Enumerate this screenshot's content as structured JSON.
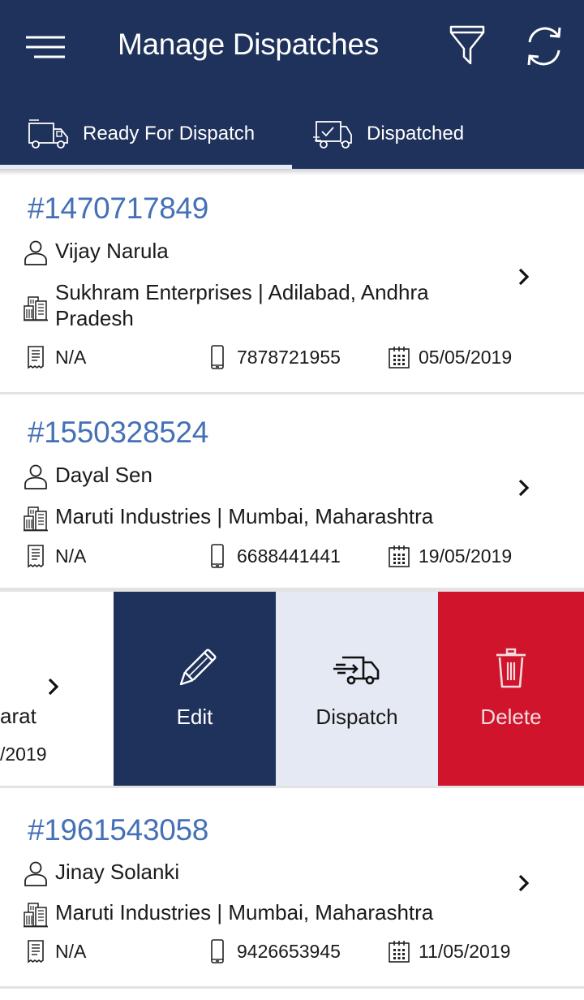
{
  "appbar": {
    "title": "Manage Dispatches",
    "menu_icon": "hamburger-menu-icon",
    "filter_icon": "filter-funnel-icon",
    "refresh_icon": "refresh-icon"
  },
  "tabs": [
    {
      "label": "Ready For Dispatch",
      "icon": "truck-icon",
      "active": true
    },
    {
      "label": "Dispatched",
      "icon": "truck-check-icon",
      "active": false
    }
  ],
  "colors": {
    "primary": "#1f325c",
    "order_id": "#4470b6",
    "delete": "#cf142b",
    "dispatch_bg": "#e5e9f3"
  },
  "orders": [
    {
      "id": "#1470717849",
      "customer": "Vijay Narula",
      "company_line1": "Sukhram Enterprises | Adilabad, Andhra",
      "company_line2": "Pradesh",
      "invoice": "N/A",
      "phone": "7878721955",
      "date": "05/05/2019"
    },
    {
      "id": "#1550328524",
      "customer": "Dayal Sen",
      "company_line1": "Maruti Industries | Mumbai, Maharashtra",
      "invoice": "N/A",
      "phone": "6688441441",
      "date": "19/05/2019"
    },
    {
      "id": "#1961543058",
      "customer": "Jinay Solanki",
      "company_line1": "Maruti Industries | Mumbai, Maharashtra",
      "invoice": "N/A",
      "phone": "9426653945",
      "date": "11/05/2019"
    }
  ],
  "swiped_row": {
    "peek_location_fragment": "arat",
    "peek_date_fragment": "/2019",
    "actions": [
      {
        "label": "Edit",
        "icon": "pencil-icon"
      },
      {
        "label": "Dispatch",
        "icon": "fast-truck-icon"
      },
      {
        "label": "Delete",
        "icon": "trash-icon"
      }
    ]
  }
}
